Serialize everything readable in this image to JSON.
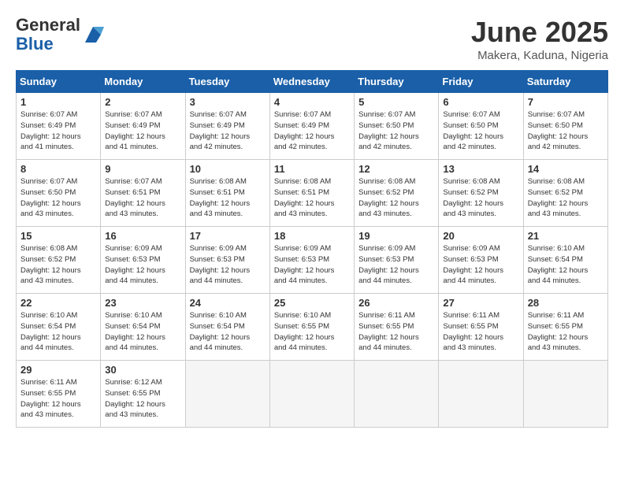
{
  "header": {
    "logo_general": "General",
    "logo_blue": "Blue",
    "month_title": "June 2025",
    "location": "Makera, Kaduna, Nigeria"
  },
  "calendar": {
    "days_of_week": [
      "Sunday",
      "Monday",
      "Tuesday",
      "Wednesday",
      "Thursday",
      "Friday",
      "Saturday"
    ],
    "weeks": [
      [
        {
          "day": "",
          "info": ""
        },
        {
          "day": "2",
          "info": "Sunrise: 6:07 AM\nSunset: 6:49 PM\nDaylight: 12 hours\nand 41 minutes."
        },
        {
          "day": "3",
          "info": "Sunrise: 6:07 AM\nSunset: 6:49 PM\nDaylight: 12 hours\nand 42 minutes."
        },
        {
          "day": "4",
          "info": "Sunrise: 6:07 AM\nSunset: 6:49 PM\nDaylight: 12 hours\nand 42 minutes."
        },
        {
          "day": "5",
          "info": "Sunrise: 6:07 AM\nSunset: 6:50 PM\nDaylight: 12 hours\nand 42 minutes."
        },
        {
          "day": "6",
          "info": "Sunrise: 6:07 AM\nSunset: 6:50 PM\nDaylight: 12 hours\nand 42 minutes."
        },
        {
          "day": "7",
          "info": "Sunrise: 6:07 AM\nSunset: 6:50 PM\nDaylight: 12 hours\nand 42 minutes."
        }
      ],
      [
        {
          "day": "8",
          "info": "Sunrise: 6:07 AM\nSunset: 6:50 PM\nDaylight: 12 hours\nand 43 minutes."
        },
        {
          "day": "9",
          "info": "Sunrise: 6:07 AM\nSunset: 6:51 PM\nDaylight: 12 hours\nand 43 minutes."
        },
        {
          "day": "10",
          "info": "Sunrise: 6:08 AM\nSunset: 6:51 PM\nDaylight: 12 hours\nand 43 minutes."
        },
        {
          "day": "11",
          "info": "Sunrise: 6:08 AM\nSunset: 6:51 PM\nDaylight: 12 hours\nand 43 minutes."
        },
        {
          "day": "12",
          "info": "Sunrise: 6:08 AM\nSunset: 6:52 PM\nDaylight: 12 hours\nand 43 minutes."
        },
        {
          "day": "13",
          "info": "Sunrise: 6:08 AM\nSunset: 6:52 PM\nDaylight: 12 hours\nand 43 minutes."
        },
        {
          "day": "14",
          "info": "Sunrise: 6:08 AM\nSunset: 6:52 PM\nDaylight: 12 hours\nand 43 minutes."
        }
      ],
      [
        {
          "day": "15",
          "info": "Sunrise: 6:08 AM\nSunset: 6:52 PM\nDaylight: 12 hours\nand 43 minutes."
        },
        {
          "day": "16",
          "info": "Sunrise: 6:09 AM\nSunset: 6:53 PM\nDaylight: 12 hours\nand 44 minutes."
        },
        {
          "day": "17",
          "info": "Sunrise: 6:09 AM\nSunset: 6:53 PM\nDaylight: 12 hours\nand 44 minutes."
        },
        {
          "day": "18",
          "info": "Sunrise: 6:09 AM\nSunset: 6:53 PM\nDaylight: 12 hours\nand 44 minutes."
        },
        {
          "day": "19",
          "info": "Sunrise: 6:09 AM\nSunset: 6:53 PM\nDaylight: 12 hours\nand 44 minutes."
        },
        {
          "day": "20",
          "info": "Sunrise: 6:09 AM\nSunset: 6:53 PM\nDaylight: 12 hours\nand 44 minutes."
        },
        {
          "day": "21",
          "info": "Sunrise: 6:10 AM\nSunset: 6:54 PM\nDaylight: 12 hours\nand 44 minutes."
        }
      ],
      [
        {
          "day": "22",
          "info": "Sunrise: 6:10 AM\nSunset: 6:54 PM\nDaylight: 12 hours\nand 44 minutes."
        },
        {
          "day": "23",
          "info": "Sunrise: 6:10 AM\nSunset: 6:54 PM\nDaylight: 12 hours\nand 44 minutes."
        },
        {
          "day": "24",
          "info": "Sunrise: 6:10 AM\nSunset: 6:54 PM\nDaylight: 12 hours\nand 44 minutes."
        },
        {
          "day": "25",
          "info": "Sunrise: 6:10 AM\nSunset: 6:55 PM\nDaylight: 12 hours\nand 44 minutes."
        },
        {
          "day": "26",
          "info": "Sunrise: 6:11 AM\nSunset: 6:55 PM\nDaylight: 12 hours\nand 44 minutes."
        },
        {
          "day": "27",
          "info": "Sunrise: 6:11 AM\nSunset: 6:55 PM\nDaylight: 12 hours\nand 43 minutes."
        },
        {
          "day": "28",
          "info": "Sunrise: 6:11 AM\nSunset: 6:55 PM\nDaylight: 12 hours\nand 43 minutes."
        }
      ],
      [
        {
          "day": "29",
          "info": "Sunrise: 6:11 AM\nSunset: 6:55 PM\nDaylight: 12 hours\nand 43 minutes."
        },
        {
          "day": "30",
          "info": "Sunrise: 6:12 AM\nSunset: 6:55 PM\nDaylight: 12 hours\nand 43 minutes."
        },
        {
          "day": "",
          "info": ""
        },
        {
          "day": "",
          "info": ""
        },
        {
          "day": "",
          "info": ""
        },
        {
          "day": "",
          "info": ""
        },
        {
          "day": "",
          "info": ""
        }
      ]
    ],
    "first_day": {
      "day": "1",
      "info": "Sunrise: 6:07 AM\nSunset: 6:49 PM\nDaylight: 12 hours\nand 41 minutes."
    }
  }
}
